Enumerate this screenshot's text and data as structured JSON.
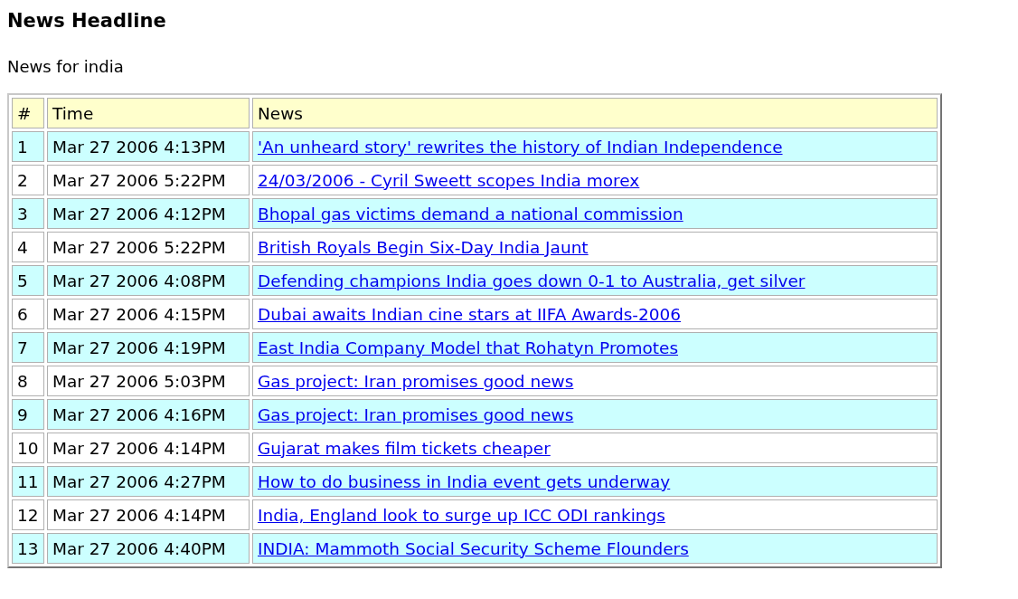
{
  "title": "News Headline",
  "subtitle": "News for india",
  "table": {
    "columns": [
      "#",
      "Time",
      "News"
    ],
    "rows": [
      {
        "number": "1",
        "time": "Mar 27 2006 4:13PM",
        "headline": "'An unheard story' rewrites the history of Indian Independence",
        "shaded": true
      },
      {
        "number": "2",
        "time": "Mar 27 2006 5:22PM",
        "headline": "24/03/2006 - Cyril Sweett scopes India morex",
        "shaded": false
      },
      {
        "number": "3",
        "time": "Mar 27 2006 4:12PM",
        "headline": "Bhopal gas victims demand a national commission",
        "shaded": true
      },
      {
        "number": "4",
        "time": "Mar 27 2006 5:22PM",
        "headline": "British Royals Begin Six-Day India Jaunt",
        "shaded": false
      },
      {
        "number": "5",
        "time": "Mar 27 2006 4:08PM",
        "headline": "Defending champions India goes down 0-1 to Australia, get silver",
        "shaded": true
      },
      {
        "number": "6",
        "time": "Mar 27 2006 4:15PM",
        "headline": "Dubai awaits Indian cine stars at IIFA Awards-2006",
        "shaded": false
      },
      {
        "number": "7",
        "time": "Mar 27 2006 4:19PM",
        "headline": "East India Company Model that Rohatyn Promotes",
        "shaded": true
      },
      {
        "number": "8",
        "time": "Mar 27 2006 5:03PM",
        "headline": "Gas project: Iran promises good news",
        "shaded": false
      },
      {
        "number": "9",
        "time": "Mar 27 2006 4:16PM",
        "headline": "Gas project: Iran promises good news",
        "shaded": true
      },
      {
        "number": "10",
        "time": "Mar 27 2006 4:14PM",
        "headline": "Gujarat makes film tickets cheaper",
        "shaded": false
      },
      {
        "number": "11",
        "time": "Mar 27 2006 4:27PM",
        "headline": "How to do business in India event gets underway",
        "shaded": true
      },
      {
        "number": "12",
        "time": "Mar 27 2006 4:14PM",
        "headline": "India, England look to surge up ICC ODI rankings",
        "shaded": false
      },
      {
        "number": "13",
        "time": "Mar 27 2006 4:40PM",
        "headline": "INDIA: Mammoth Social Security Scheme Flounders",
        "shaded": true
      }
    ]
  }
}
